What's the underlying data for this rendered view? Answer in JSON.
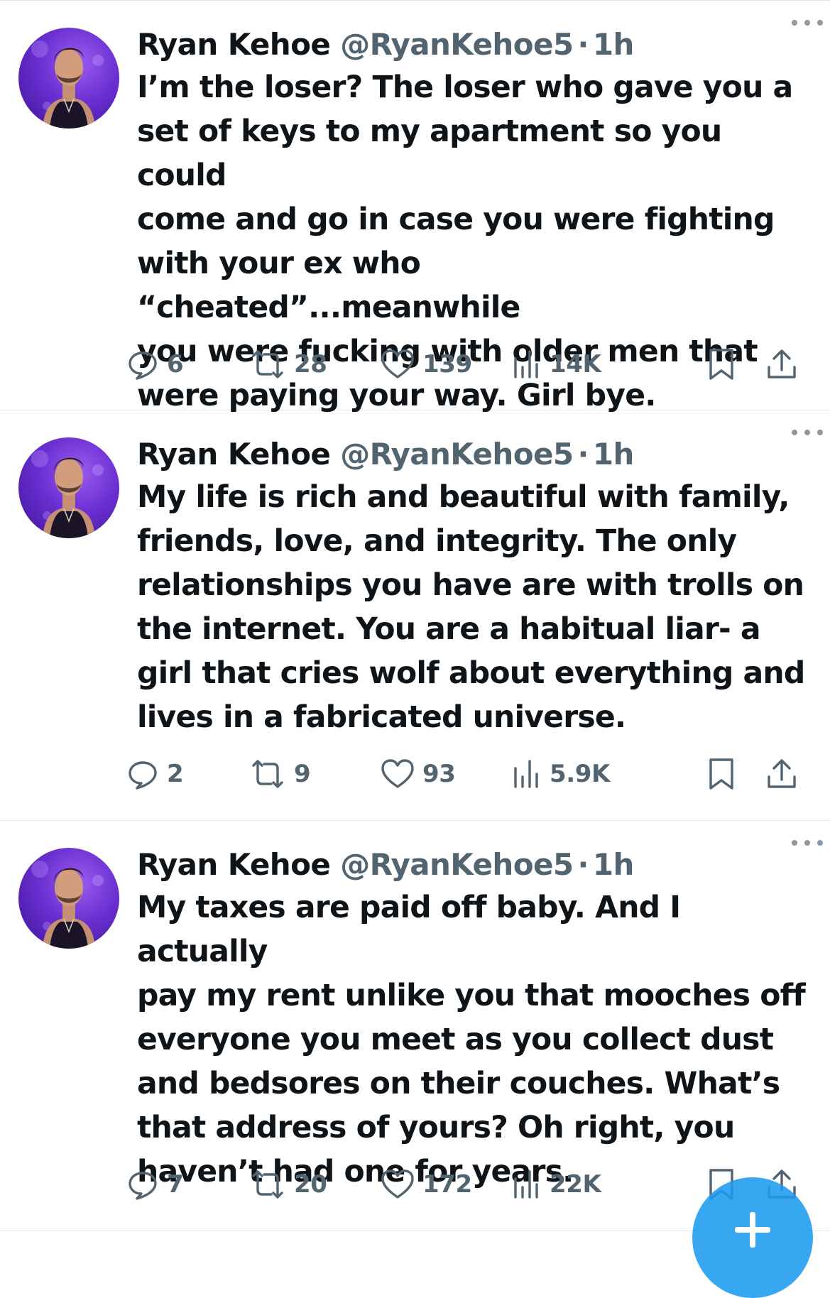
{
  "tweets": [
    {
      "author": {
        "name": "Ryan Kehoe",
        "handle": "@RyanKehoe5"
      },
      "separator": "·",
      "time": "1h",
      "text": "I’m the loser? The loser who gave you a\nset of keys to my apartment so you could\ncome and go in case you were fighting\nwith your ex who “cheated”...meanwhile\nyou were fucking with older men that\nwere paying your way. Girl bye.",
      "stats": {
        "replies": "6",
        "reposts": "28",
        "likes": "139",
        "views": "14K"
      }
    },
    {
      "author": {
        "name": "Ryan Kehoe",
        "handle": "@RyanKehoe5"
      },
      "separator": "·",
      "time": "1h",
      "text": "My life is rich and beautiful with family,\nfriends, love, and integrity. The only\nrelationships you have are with trolls on\nthe internet. You are a habitual  liar- a\ngirl that cries wolf about everything and\nlives in a fabricated universe.",
      "stats": {
        "replies": "2",
        "reposts": "9",
        "likes": "93",
        "views": "5.9K"
      }
    },
    {
      "author": {
        "name": "Ryan Kehoe",
        "handle": "@RyanKehoe5"
      },
      "separator": "·",
      "time": "1h",
      "text": "My taxes are paid off baby. And I actually\npay my rent unlike you that mooches off\neveryone you meet as you collect dust\nand bedsores on their couches. What’s\nthat address of yours? Oh right, you\nhaven’t had one for years.",
      "stats": {
        "replies": "7",
        "reposts": "20",
        "likes": "172",
        "views": "22K"
      }
    }
  ],
  "icons": {
    "reply": "speech-bubble-icon",
    "repost": "repost-arrows-icon",
    "like": "heart-icon",
    "views": "bar-chart-icon",
    "bookmark": "bookmark-icon",
    "share": "share-upload-icon",
    "more": "ellipsis-icon",
    "compose": "plus-icon"
  },
  "colors": {
    "text": "#0f1419",
    "secondary": "#536471",
    "divider": "#e1e5e8",
    "accent": "#1d9bf0",
    "avatar_background": "#6a2fd1"
  }
}
